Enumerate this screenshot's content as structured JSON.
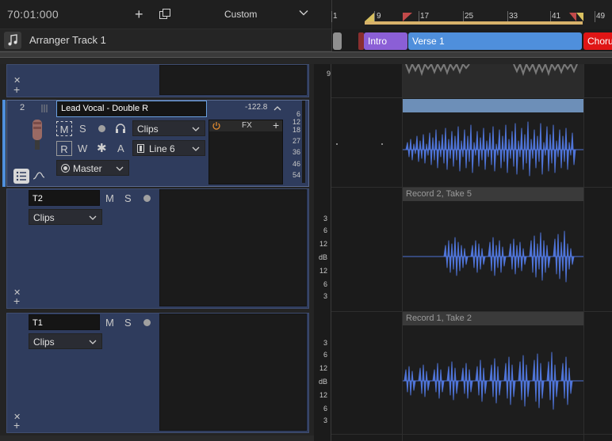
{
  "toolbar": {
    "timecode": "70:01:000",
    "add_icon": "plus-icon",
    "duplicate_icon": "duplicate-icon",
    "preset_label": "Custom"
  },
  "ruler": {
    "ticks": [
      "1",
      "9",
      "17",
      "25",
      "33",
      "41",
      "49"
    ]
  },
  "arranger": {
    "track_name": "Arranger Track 1",
    "sections": [
      {
        "label": "Intro",
        "color": "#8b5fd6"
      },
      {
        "label": "Verse 1",
        "color": "#4f8fdc"
      },
      {
        "label": "Chorus",
        "color": "#e01515"
      }
    ]
  },
  "tracks": {
    "top_partial": {
      "db_scale": [
        "9"
      ]
    },
    "track2": {
      "number": "2",
      "name": "Lead Vocal - Double R",
      "peak_value": "-122.8",
      "mute": "M",
      "solo": "S",
      "read": "R",
      "write": "W",
      "automation": "A",
      "clip_mode": "Clips",
      "input": "Line 6",
      "output": "Master",
      "fx_label": "FX",
      "meter_scale": [
        "6",
        "12",
        "18",
        "27",
        "36",
        "46",
        "54"
      ]
    },
    "t2": {
      "name": "T2",
      "mute": "M",
      "solo": "S",
      "clip_mode": "Clips",
      "clip_name": "Record 2, Take 5",
      "db_scale": [
        "3",
        "6",
        "12",
        "dB",
        "12",
        "6",
        "3"
      ]
    },
    "t1": {
      "name": "T1",
      "mute": "M",
      "solo": "S",
      "clip_mode": "Clips",
      "clip_name": "Record 1, Take 2",
      "db_scale": [
        "3",
        "6",
        "12",
        "dB",
        "12",
        "6",
        "3"
      ]
    }
  },
  "colors": {
    "track_panel": "#2f3c5d",
    "waveform": "#4f74d8",
    "loop_bar": "#d8b26a"
  }
}
